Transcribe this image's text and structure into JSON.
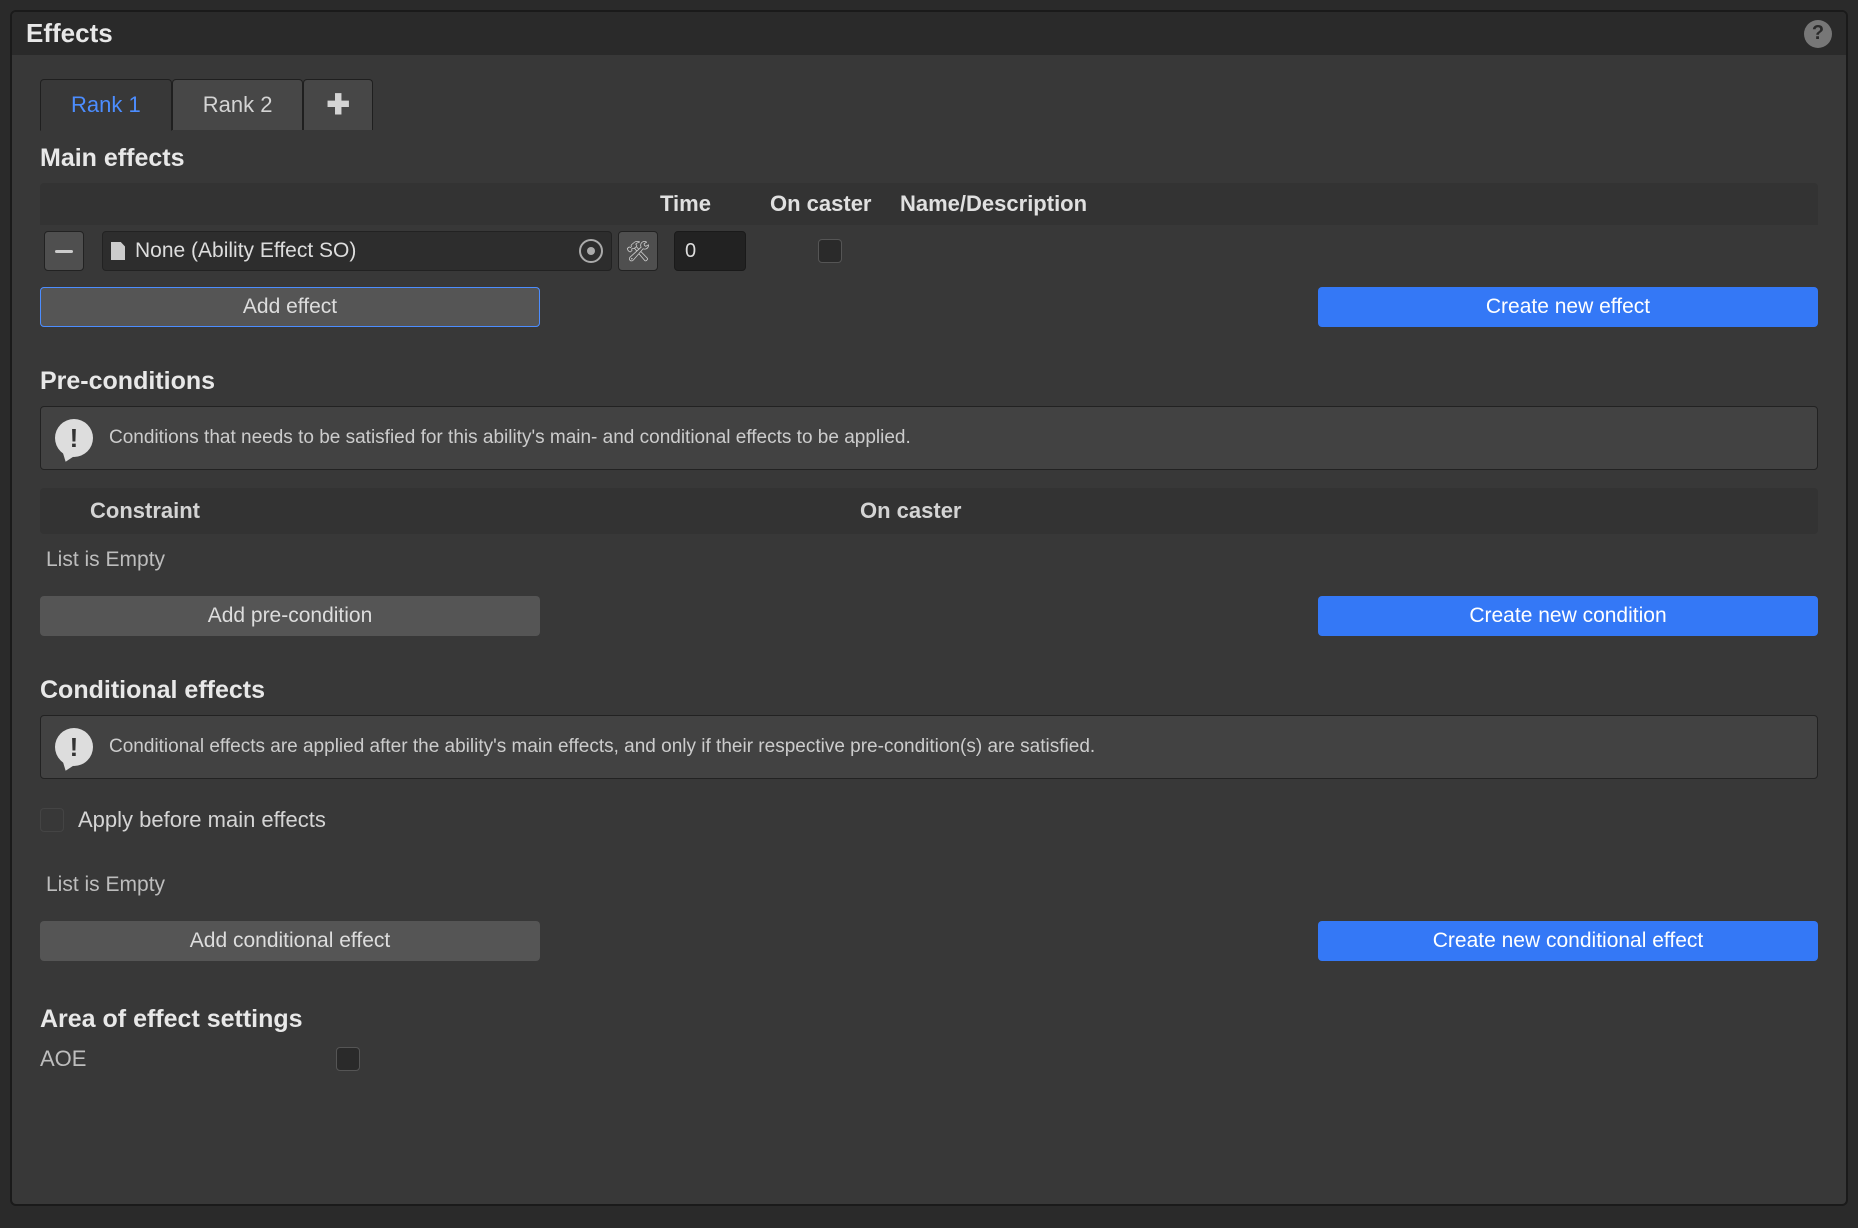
{
  "panel": {
    "title": "Effects"
  },
  "tabs": [
    {
      "label": "Rank 1",
      "active": true
    },
    {
      "label": "Rank 2",
      "active": false
    }
  ],
  "sections": {
    "main_effects": {
      "title": "Main effects",
      "headers": {
        "time": "Time",
        "on_caster": "On caster",
        "name_desc": "Name/Description"
      },
      "row0": {
        "object_label": "None (Ability Effect SO)",
        "time_value": "0"
      },
      "add_btn": "Add effect",
      "create_btn": "Create new effect"
    },
    "pre_conditions": {
      "title": "Pre-conditions",
      "info": "Conditions that needs to be satisfied for this ability's main- and conditional effects to be applied.",
      "headers": {
        "constraint": "Constraint",
        "on_caster": "On caster"
      },
      "empty": "List is Empty",
      "add_btn": "Add pre-condition",
      "create_btn": "Create new condition"
    },
    "conditional_effects": {
      "title": "Conditional effects",
      "info": "Conditional effects are applied after the ability's main effects, and only if their respective pre-condition(s) are satisfied.",
      "apply_before_label": "Apply before main effects",
      "empty": "List is Empty",
      "add_btn": "Add conditional effect",
      "create_btn": "Create new conditional effect"
    },
    "aoe": {
      "title": "Area of effect settings",
      "label": "AOE"
    }
  }
}
